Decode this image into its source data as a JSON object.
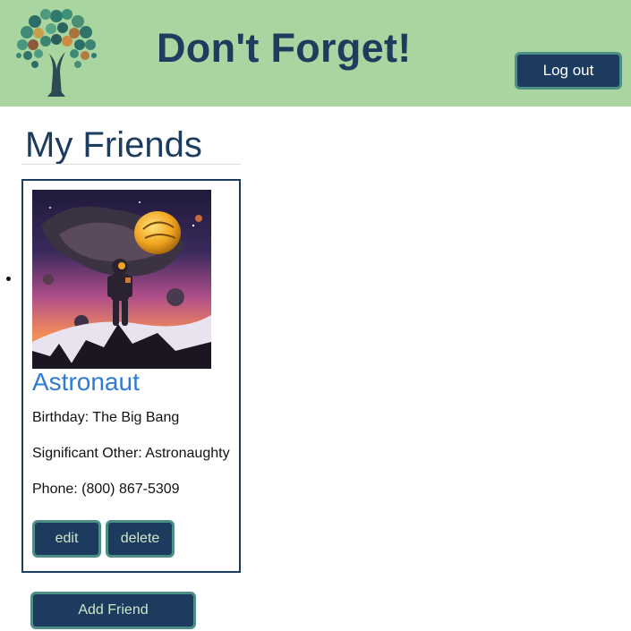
{
  "header": {
    "title": "Don't Forget!",
    "logout_label": "Log out",
    "logo_icon": "tree-logo-icon",
    "background_color": "#a9d5a0"
  },
  "main": {
    "section_title": "My Friends",
    "friends": [
      {
        "name": "Astronaut",
        "photo_icon": "astronaut-space-illustration",
        "birthday": "Birthday: The Big Bang",
        "significant_other": "Significant Other: Astronaughty",
        "phone": "Phone: (800) 867-5309",
        "edit_label": "edit",
        "delete_label": "delete"
      }
    ],
    "add_friend_label": "Add Friend"
  },
  "colors": {
    "primary_dark": "#1d3a5f",
    "button_text": "#cfe8c9",
    "button_border": "#4d8f86",
    "link_blue": "#2e7ad8"
  }
}
